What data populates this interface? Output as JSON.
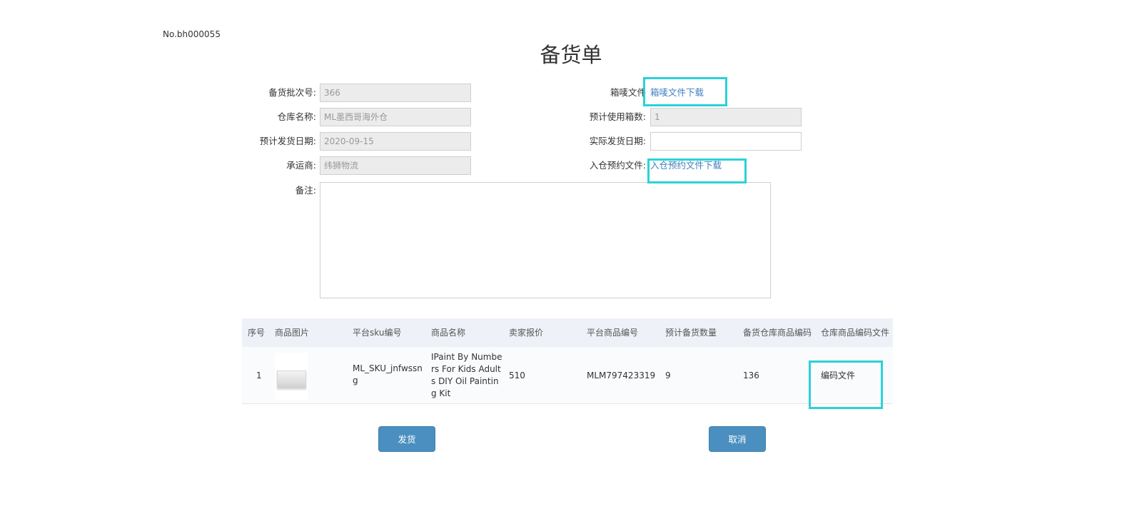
{
  "doc_no": "No.bh000055",
  "title": "备货单",
  "form": {
    "batch_no": {
      "label": "备货批次号:",
      "value": "366"
    },
    "warehouse": {
      "label": "仓库名称:",
      "value": "ML墨西哥海外仓"
    },
    "est_ship_date": {
      "label": "预计发货日期:",
      "value": "2020-09-15"
    },
    "carrier": {
      "label": "承运商:",
      "value": "纬狮物流"
    },
    "remark": {
      "label": "备注:",
      "value": ""
    },
    "box_label_file": {
      "label": "箱唛文件",
      "link": "箱唛文件下载"
    },
    "est_boxes": {
      "label": "预计使用箱数:",
      "value": "1"
    },
    "actual_ship_date": {
      "label": "实际发货日期:",
      "value": ""
    },
    "inbound_appt_file": {
      "label": "入仓预约文件:",
      "link": "入仓预约文件下载"
    }
  },
  "table": {
    "headers": [
      "序号",
      "商品图片",
      "平台sku编号",
      "商品名称",
      "卖家报价",
      "平台商品编号",
      "预计备货数量",
      "备货仓库商品编码",
      "仓库商品编码文件"
    ],
    "rows": [
      {
        "index": "1",
        "sku": "ML_SKU_jnfwssng",
        "name": "IPaint By Numbers For Kids Adults DIY Oil Painting Kit",
        "price": "510",
        "platform_no": "MLM797423319",
        "qty": "9",
        "wh_code": "136",
        "code_file": "编码文件"
      }
    ]
  },
  "buttons": {
    "ship": "发货",
    "cancel": "取消"
  },
  "colors": {
    "accent": "#4a8fbf",
    "link": "#3f7fbf",
    "highlight": "#2ad2d8"
  }
}
